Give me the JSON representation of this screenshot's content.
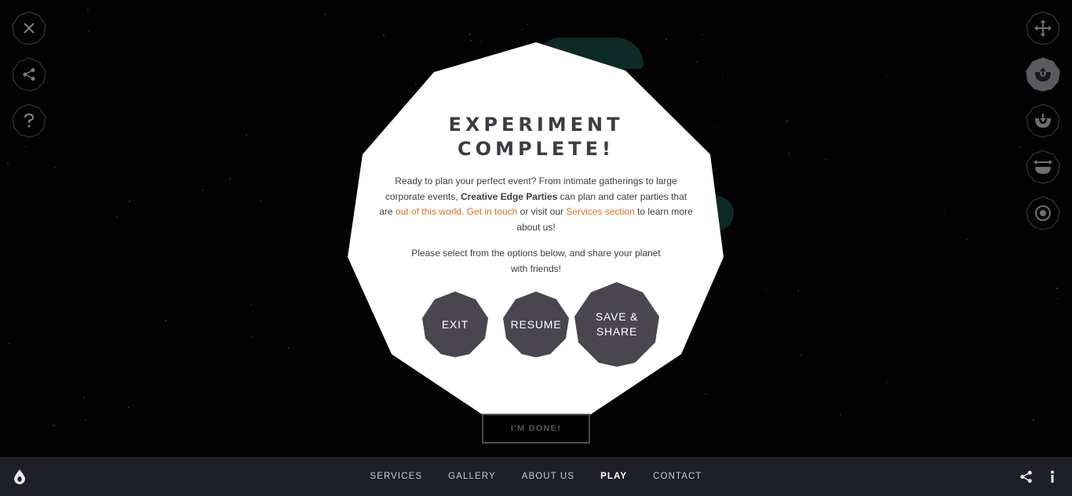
{
  "modal": {
    "title_line1": "EXPERIMENT",
    "title_line2": "COMPLETE!",
    "para1": {
      "part1": "Ready to plan your perfect event? From intimate gatherings to large corporate events, ",
      "brand": "Creative Edge Parties",
      "part2": " can plan and cater parties that are ",
      "link1": "out of this world.",
      "space": " ",
      "link2": "Get in touch",
      "part3": " or visit our ",
      "link3": "Services section",
      "part4": " to learn more about us!"
    },
    "para2": "Please select from the options below, and share your planet with friends!",
    "buttons": {
      "exit": "EXIT",
      "resume": "RESUME",
      "save_line1": "SAVE &",
      "save_line2": "SHARE"
    }
  },
  "done_button": "I'M DONE!",
  "left_tools": [
    "close-icon",
    "share-icon",
    "help-icon"
  ],
  "right_tools": [
    "move-icon",
    "raise-icon",
    "lower-icon",
    "stretch-icon",
    "target-icon"
  ],
  "nav": {
    "services": "SERVICES",
    "gallery": "GALLERY",
    "about": "ABOUT US",
    "play": "PLAY",
    "contact": "CONTACT"
  },
  "colors": {
    "accent": "#d8711f",
    "button_fill": "#4a4650",
    "footer": "#1f1f27",
    "modal_text": "#3f3b43"
  }
}
